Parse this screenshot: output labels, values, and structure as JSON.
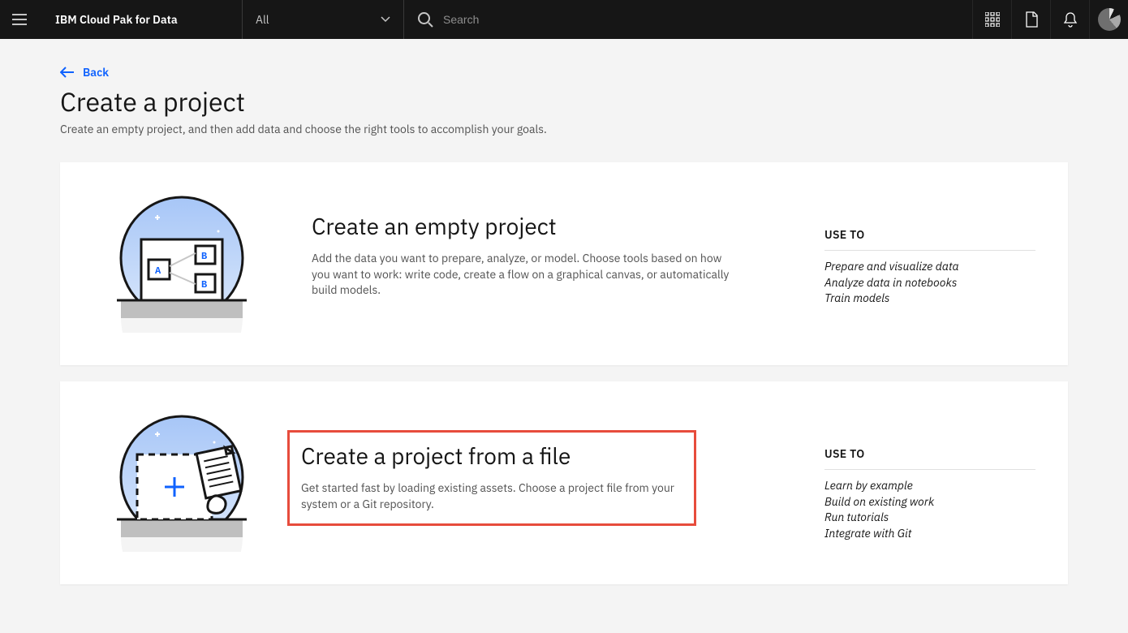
{
  "header": {
    "brand": "IBM Cloud Pak for Data",
    "filter_label": "All",
    "search_placeholder": "Search"
  },
  "page": {
    "back_label": "Back",
    "title": "Create a project",
    "subtitle": "Create an empty project, and then add data and choose the right tools to accomplish your goals."
  },
  "cards": [
    {
      "title": "Create an empty project",
      "desc": "Add the data you want to prepare, analyze, or model. Choose tools based on how you want to work: write code, create a flow on a graphical canvas, or automatically build models.",
      "useto_label": "USE TO",
      "useto": [
        "Prepare and visualize data",
        "Analyze data in notebooks",
        "Train models"
      ]
    },
    {
      "title": "Create a project from a file",
      "desc": "Get started fast by loading existing assets. Choose a project file from your system or a Git repository.",
      "useto_label": "USE TO",
      "useto": [
        "Learn by example",
        "Build on existing work",
        "Run tutorials",
        "Integrate with Git"
      ]
    }
  ]
}
